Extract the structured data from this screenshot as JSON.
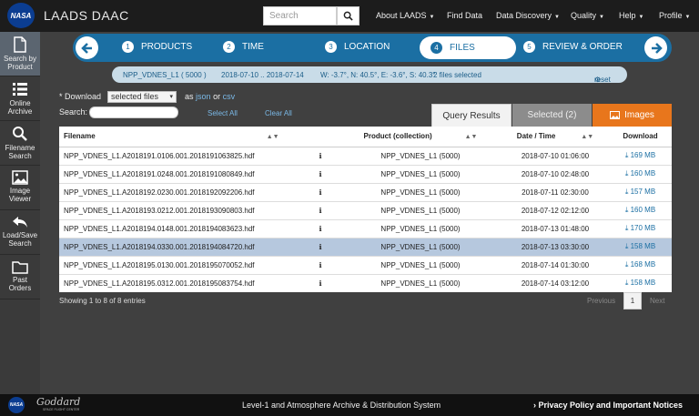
{
  "header": {
    "logo_text": "NASA",
    "app_title": "LAADS DAAC",
    "search_placeholder": "Search",
    "nav": [
      {
        "label": "About LAADS",
        "caret": true
      },
      {
        "label": "Find Data",
        "caret": false
      },
      {
        "label": "Data Discovery",
        "caret": true
      },
      {
        "label": "Quality",
        "caret": true
      },
      {
        "label": "Help",
        "caret": true
      },
      {
        "label": "Profile",
        "caret": true
      }
    ]
  },
  "sidebar": {
    "items": [
      {
        "label1": "Search by",
        "label2": "Product",
        "icon": "document-icon"
      },
      {
        "label1": "Online",
        "label2": "Archive",
        "icon": "list-icon"
      },
      {
        "label1": "Filename",
        "label2": "Search",
        "icon": "magnifier-icon"
      },
      {
        "label1": "Image",
        "label2": "Viewer",
        "icon": "image-icon"
      },
      {
        "label1": "Load/Save",
        "label2": "Search",
        "icon": "undo-icon"
      },
      {
        "label1": "Past",
        "label2": "Orders",
        "icon": "folder-icon"
      }
    ]
  },
  "steps": [
    {
      "num": "1",
      "label": "PRODUCTS"
    },
    {
      "num": "2",
      "label": "TIME"
    },
    {
      "num": "3",
      "label": "LOCATION"
    },
    {
      "num": "4",
      "label": "FILES"
    },
    {
      "num": "5",
      "label": "REVIEW & ORDER"
    }
  ],
  "summary": {
    "product": "NPP_VDNES_L1 ( 5000 )",
    "dates": "2018-07-10 .. 2018-07-14",
    "bbox": "W: -3.7°, N: 40.5°, E: -3.6°, S: 40.3°",
    "selected": "2 files selected",
    "reset": "reset"
  },
  "controls": {
    "download_label": "* Download",
    "download_value": "selected files",
    "as_label": "as",
    "json_link": "json",
    "or_label": "or",
    "csv_link": "csv",
    "search_label": "Search:",
    "select_all": "Select All",
    "clear_all": "Clear All"
  },
  "tabs": {
    "query": "Query Results",
    "selected": "Selected (2)",
    "images": "Images"
  },
  "table": {
    "headers": {
      "filename": "Filename",
      "product": "Product (collection)",
      "date": "Date / Time",
      "download": "Download"
    },
    "rows": [
      {
        "filename": "NPP_VDNES_L1.A2018191.0106.001.2018191063825.hdf",
        "product": "NPP_VDNES_L1 (5000)",
        "date": "2018-07-10 01:06:00",
        "size": "169 MB"
      },
      {
        "filename": "NPP_VDNES_L1.A2018191.0248.001.2018191080849.hdf",
        "product": "NPP_VDNES_L1 (5000)",
        "date": "2018-07-10 02:48:00",
        "size": "160 MB"
      },
      {
        "filename": "NPP_VDNES_L1.A2018192.0230.001.2018192092206.hdf",
        "product": "NPP_VDNES_L1 (5000)",
        "date": "2018-07-11 02:30:00",
        "size": "157 MB"
      },
      {
        "filename": "NPP_VDNES_L1.A2018193.0212.001.2018193090803.hdf",
        "product": "NPP_VDNES_L1 (5000)",
        "date": "2018-07-12 02:12:00",
        "size": "160 MB"
      },
      {
        "filename": "NPP_VDNES_L1.A2018194.0148.001.2018194083623.hdf",
        "product": "NPP_VDNES_L1 (5000)",
        "date": "2018-07-13 01:48:00",
        "size": "170 MB"
      },
      {
        "filename": "NPP_VDNES_L1.A2018194.0330.001.2018194084720.hdf",
        "product": "NPP_VDNES_L1 (5000)",
        "date": "2018-07-13 03:30:00",
        "size": "158 MB"
      },
      {
        "filename": "NPP_VDNES_L1.A2018195.0130.001.2018195070052.hdf",
        "product": "NPP_VDNES_L1 (5000)",
        "date": "2018-07-14 01:30:00",
        "size": "168 MB"
      },
      {
        "filename": "NPP_VDNES_L1.A2018195.0312.001.2018195083754.hdf",
        "product": "NPP_VDNES_L1 (5000)",
        "date": "2018-07-14 03:12:00",
        "size": "158 MB"
      }
    ]
  },
  "pagination": {
    "info": "Showing 1 to 8 of 8 entries",
    "previous": "Previous",
    "page": "1",
    "next": "Next"
  },
  "footer": {
    "nasa": "NASA",
    "goddard": "Goddard",
    "goddard_sub": "SPACE FLIGHT CENTER",
    "center_text": "Level-1 and Atmosphere Archive & Distribution System",
    "privacy": "Privacy Policy and Important Notices"
  },
  "colors": {
    "accent": "#1b6fa3",
    "images_tab": "#e8761c",
    "selected_row": "#b6c8de"
  }
}
